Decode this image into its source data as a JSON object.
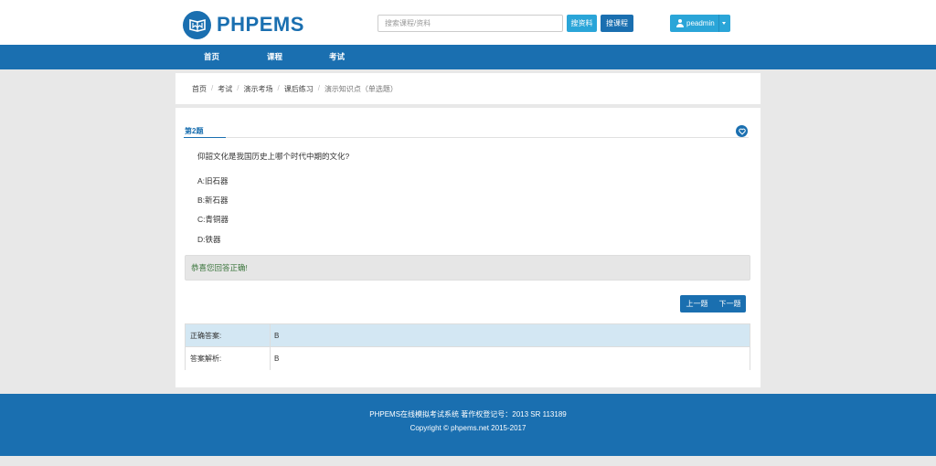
{
  "header": {
    "logo_text": "PHPEMS",
    "search_placeholder": "搜索课程/资料",
    "search_resources_label": "搜资料",
    "search_courses_label": "搜课程",
    "user_name": "peadmin"
  },
  "nav": {
    "items": [
      "首页",
      "课程",
      "考试"
    ]
  },
  "breadcrumb": [
    "首页",
    "考试",
    "演示考场",
    "课后练习",
    "演示知识点（单选题）"
  ],
  "question": {
    "number_label": "第2题",
    "text": "仰韶文化是我国历史上哪个时代中期的文化?",
    "options": [
      "A:旧石器",
      "B:新石器",
      "C:青铜器",
      "D:铁器"
    ],
    "feedback": "恭喜您回答正确!",
    "prev_label": "上一题",
    "next_label": "下一题",
    "answer_rows": [
      {
        "label": "正确答案:",
        "value": "B"
      },
      {
        "label": "答案解析:",
        "value": "B"
      }
    ]
  },
  "footer": {
    "line1": "PHPEMS在线模拟考试系统 著作权登记号：2013 SR 113189",
    "line2": "Copyright © phpems.net 2015-2017"
  },
  "colors": {
    "brand": "#1a6fb0",
    "accent": "#2aa5d8",
    "success_text": "#3c763d"
  },
  "icons": {
    "logo": "book-logo-icon",
    "user": "user-icon",
    "favorite": "heart-icon"
  }
}
